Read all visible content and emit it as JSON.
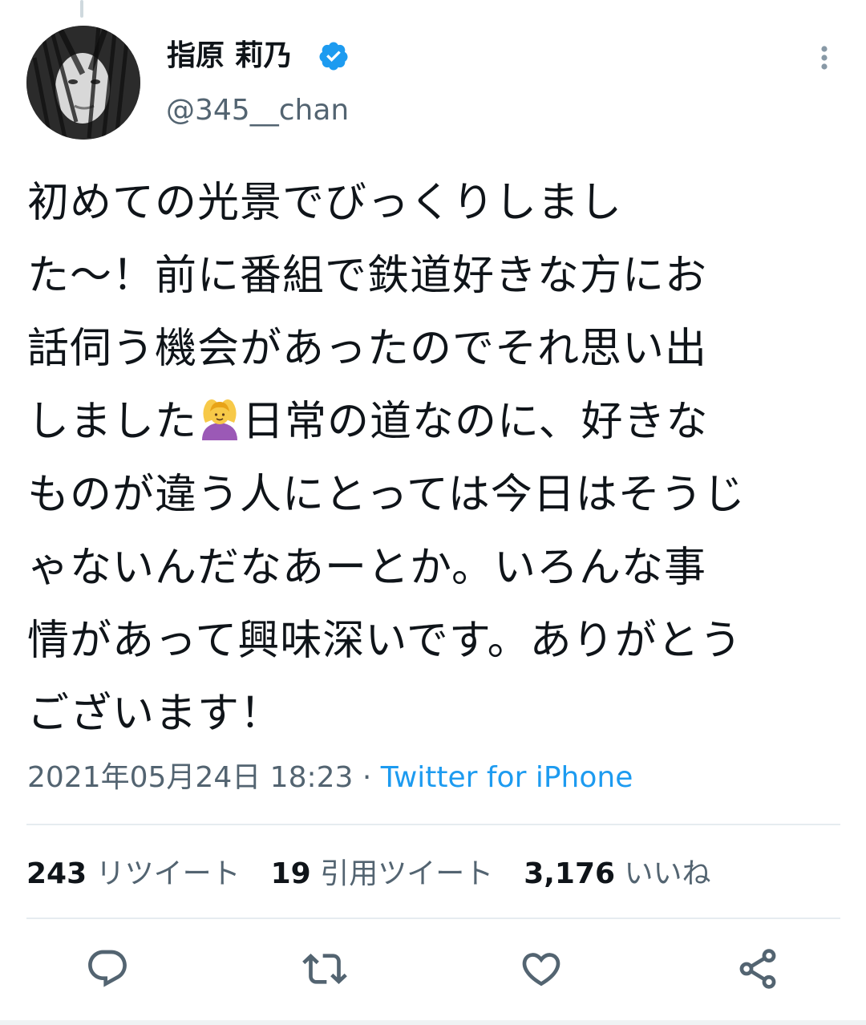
{
  "tweet": {
    "display_name": "指原 莉乃",
    "handle": "@345__chan",
    "verified": true,
    "avatar_icon": "profile-photo",
    "text_lines": [
      "初めての光景でびっくりしまし",
      "た〜！前に番組で鉄道好きな方にお",
      "話伺う機会があったのでそれ思い出",
      "しました",
      "日常の道なのに、好きな",
      "ものが違う人にとっては今日はそうじ",
      "ゃないんだなあーとか。いろんな事",
      "情があって興味深いです。ありがとう",
      "ございます！"
    ],
    "emoji_icon": "woman-gesturing-ok-emoji",
    "timestamp": "2021年05月24日 18:23",
    "separator": " · ",
    "source": "Twitter for iPhone"
  },
  "stats": {
    "retweets_count": "243",
    "retweets_label": "リツイート",
    "quotes_count": "19",
    "quotes_label": "引用ツイート",
    "likes_count": "3,176",
    "likes_label": "いいね"
  },
  "icons": {
    "reply": "reply-icon",
    "retweet": "retweet-icon",
    "like": "like-icon",
    "share": "share-icon",
    "more": "more-vertical-icon"
  },
  "colors": {
    "accent": "#1d9bf0",
    "text": "#0f1419",
    "muted": "#536471"
  }
}
